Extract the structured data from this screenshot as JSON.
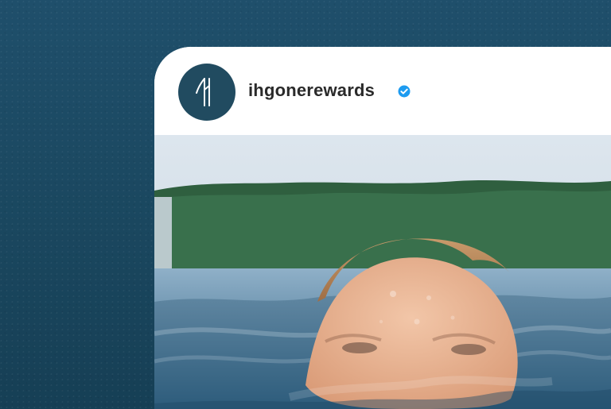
{
  "profile": {
    "username": "ihgonerewards",
    "verified": true
  },
  "icons": {
    "avatar": "brand-logo-icon",
    "verified": "verified-badge-icon"
  },
  "colors": {
    "background": "#1d4b66",
    "avatar_background": "#214b60",
    "verified_blue": "#1d9bf0",
    "username_text": "#2a2a2a"
  }
}
